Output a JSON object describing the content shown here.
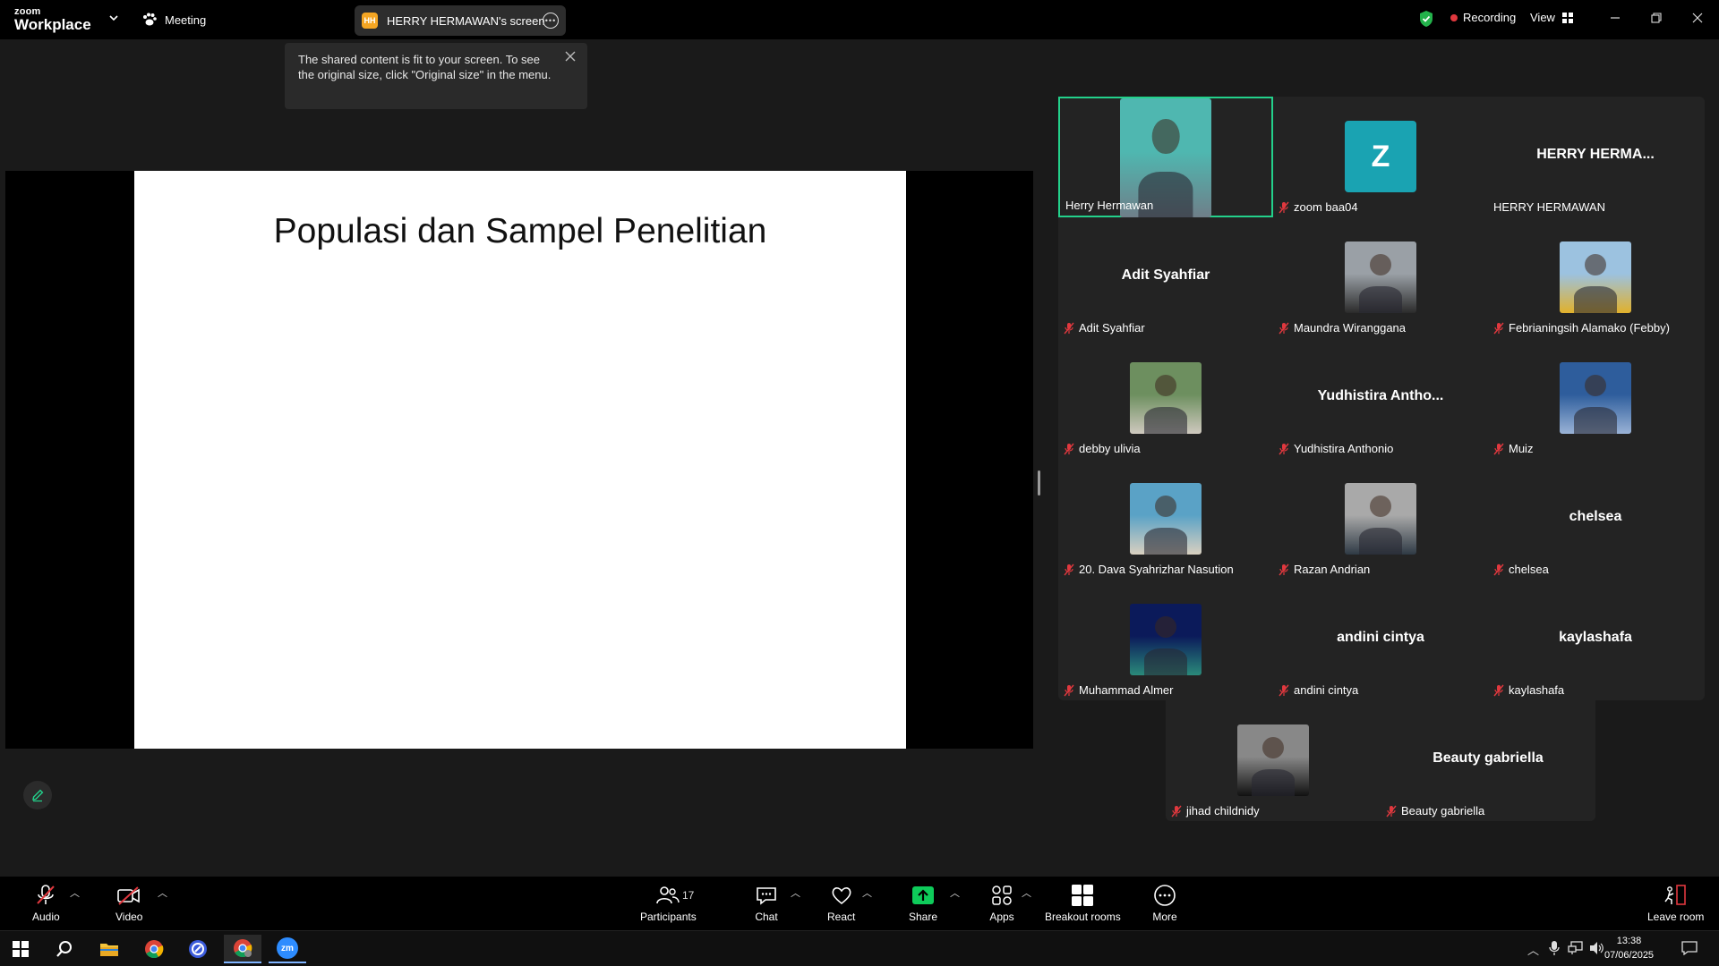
{
  "app": {
    "logo_small": "zoom",
    "logo_large": "Workplace",
    "meeting_label": "Meeting",
    "screen_share_owner_initials": "HH",
    "screen_share_label": "HERRY HERMAWAN's screen",
    "recording_label": "Recording",
    "view_label": "View"
  },
  "tooltip": {
    "text": "The shared content is fit to your screen. To see the original size, click \"Original size\" in the menu."
  },
  "slide": {
    "title": "Populasi dan Sampel Penelitian"
  },
  "participants": [
    {
      "name": "Herry Hermawan",
      "muted": false,
      "type": "photo",
      "active": true
    },
    {
      "name": "zoom baa04",
      "muted": true,
      "type": "letter",
      "letter": "Z"
    },
    {
      "name": "HERRY HERMAWAN",
      "muted": false,
      "type": "text",
      "display": "HERRY  HERMA..."
    },
    {
      "name": "Adit Syahfiar",
      "muted": true,
      "type": "text",
      "display": "Adit Syahfiar"
    },
    {
      "name": "Maundra Wiranggana",
      "muted": true,
      "type": "photo"
    },
    {
      "name": "Febrianingsih Alamako (Febby)",
      "muted": true,
      "type": "photo"
    },
    {
      "name": "debby ulivia",
      "muted": true,
      "type": "photo"
    },
    {
      "name": "Yudhistira Anthonio",
      "muted": true,
      "type": "text",
      "display": "Yudhistira  Antho..."
    },
    {
      "name": "Muiz",
      "muted": true,
      "type": "photo"
    },
    {
      "name": "20. Dava Syahrizhar Nasution",
      "muted": true,
      "type": "photo"
    },
    {
      "name": "Razan Andrian",
      "muted": true,
      "type": "photo"
    },
    {
      "name": "chelsea",
      "muted": true,
      "type": "text",
      "display": "chelsea"
    },
    {
      "name": "Muhammad Almer",
      "muted": true,
      "type": "photo"
    },
    {
      "name": "andini cintya",
      "muted": true,
      "type": "text",
      "display": "andini cintya"
    },
    {
      "name": "kaylashafa",
      "muted": true,
      "type": "text",
      "display": "kaylashafa"
    },
    {
      "name": "jihad childnidy",
      "muted": true,
      "type": "photo"
    },
    {
      "name": "Beauty gabriella",
      "muted": true,
      "type": "text",
      "display": "Beauty gabriella"
    }
  ],
  "toolbar": {
    "audio": "Audio",
    "video": "Video",
    "participants": "Participants",
    "participants_count": "17",
    "chat": "Chat",
    "react": "React",
    "share": "Share",
    "apps": "Apps",
    "breakout": "Breakout rooms",
    "more": "More",
    "leave": "Leave room"
  },
  "taskbar": {
    "time": "13:38",
    "date": "07/06/2025",
    "zoom_app_label": "zm"
  },
  "colors": {
    "active_speaker": "#23d18b",
    "recording": "#e0383e",
    "share_green": "#0ecb5a",
    "mute_red": "#e0383e"
  }
}
